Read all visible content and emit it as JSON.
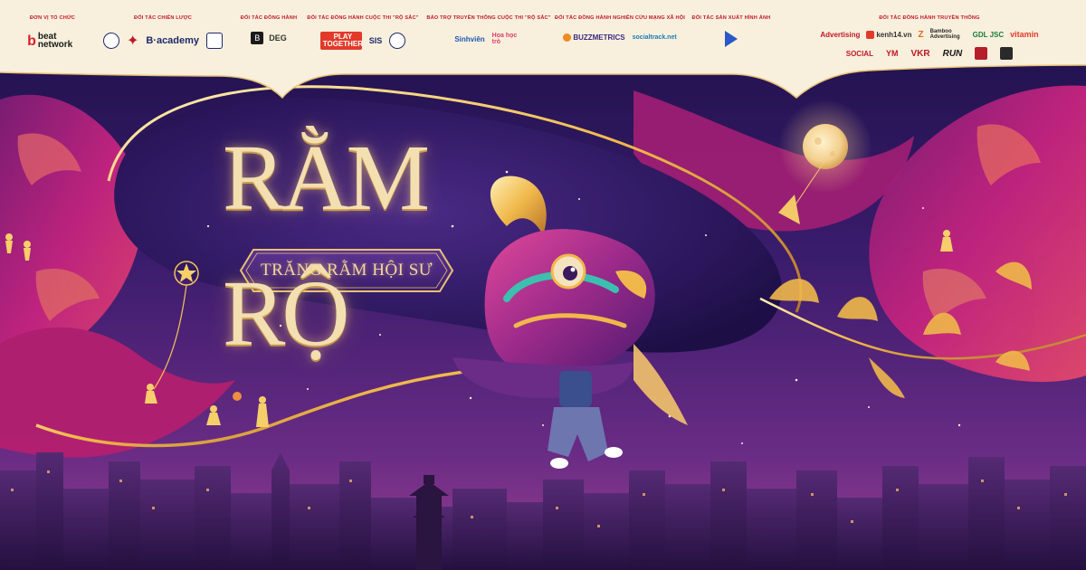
{
  "title": {
    "main": "RẰM RỘ",
    "subtitle": "TRĂNG RẰM HỘI SƯ"
  },
  "sponsors": {
    "organizer": {
      "label": "ĐƠN VỊ TỔ CHỨC",
      "logos": [
        "beat network"
      ]
    },
    "strategic": {
      "label": "ĐỐI TÁC CHIẾN LƯỢC",
      "logos": [
        "B·academy"
      ]
    },
    "companion": {
      "label": "ĐỐI TÁC ĐỒNG HÀNH",
      "logos": [
        "DEG"
      ]
    },
    "contest_companion": {
      "label": "ĐỐI TÁC ĐỒNG HÀNH CUỘC THI \"RỘ SẮC\"",
      "logos": [
        "PLAY TOGETHER",
        "SIS"
      ]
    },
    "media_contest": {
      "label": "BẢO TRỢ TRUYỀN THÔNG CUỘC THI \"RỘ SẮC\"",
      "logos": [
        "Sinhviên",
        "Hoa học trò"
      ]
    },
    "research": {
      "label": "ĐỐI TÁC ĐỒNG HÀNH NGHIÊN CỨU MẠNG XÃ HỘI",
      "logos": [
        "BUZZMETRICS",
        "socialtrack.net"
      ]
    },
    "production": {
      "label": "ĐỐI TÁC SẢN XUẤT HÌNH ẢNH",
      "logos": []
    },
    "media": {
      "label": "ĐỐI TÁC ĐỒNG HÀNH TRUYỀN THÔNG",
      "row1": [
        "Advertising",
        "kenh14.vn",
        "Z",
        "Bamboo Advertising",
        "GDL JSC",
        "vitamin"
      ],
      "row2": [
        "SOCIAL",
        "YM",
        "VKR",
        "RUN"
      ]
    }
  },
  "colors": {
    "cream": "#f8f0dc",
    "title_gold": "#f3dfb0",
    "sponsor_red": "#c0172a",
    "night": "#3b1f6e",
    "magenta": "#c5247f",
    "gold": "#f0b84a"
  }
}
